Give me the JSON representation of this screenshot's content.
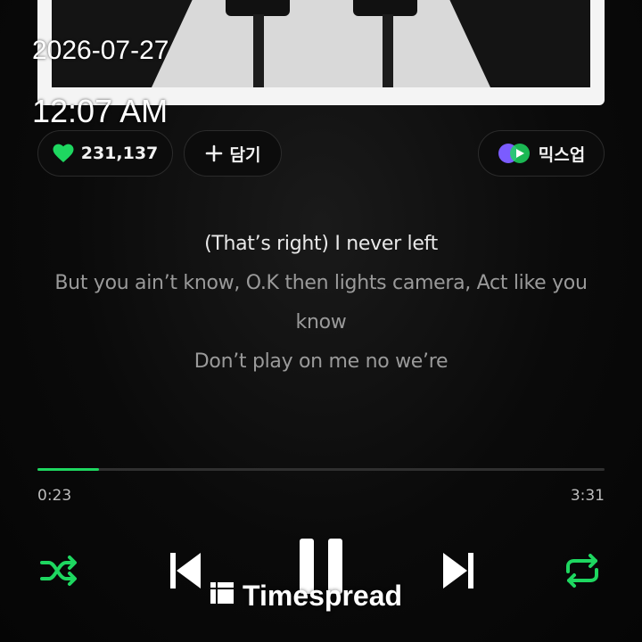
{
  "status": {
    "date": "2026-07-27",
    "time": "12:07 AM"
  },
  "actions": {
    "like_count": "231,137",
    "add_label": "담기",
    "mixup_label": "믹스업"
  },
  "lyrics": [
    {
      "text": "(That’s right) I never left",
      "state": "current"
    },
    {
      "text": "But you ain’t know, O.K then lights camera, Act like you know",
      "state": "next"
    },
    {
      "text": "Don’t play on me no we’re",
      "state": "next"
    }
  ],
  "playback": {
    "elapsed": "0:23",
    "total": "3:31",
    "progress_fraction": 0.109
  },
  "controls": {
    "shuffle_icon": "shuffle-icon",
    "prev_icon": "skip-previous-icon",
    "pause_icon": "pause-icon",
    "next_icon": "skip-next-icon",
    "repeat_icon": "repeat-icon"
  },
  "colors": {
    "accent": "#1ed760",
    "background": "#050505"
  },
  "watermark": {
    "text": "Timespread"
  }
}
